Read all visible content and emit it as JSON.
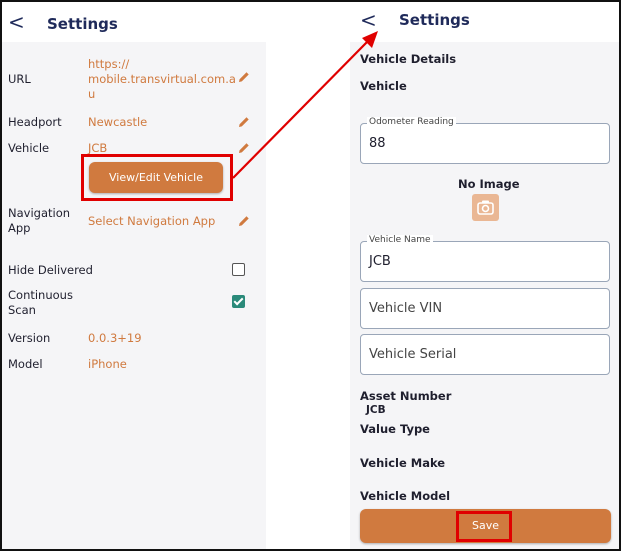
{
  "left": {
    "back_glyph": "<",
    "title": "Settings",
    "rows": [
      {
        "label": "URL",
        "value": "https://\nmobile.transvirtual.com.a\nu"
      },
      {
        "label": "Headport",
        "value": "Newcastle"
      },
      {
        "label": "Vehicle",
        "value": "JCB"
      },
      {
        "label": "Navigation\nApp",
        "value": "Select Navigation App"
      },
      {
        "label": "Hide Delivered",
        "checked": false
      },
      {
        "label": "Continuous\nScan",
        "checked": true
      },
      {
        "label": "Version",
        "value": "0.0.3+19"
      },
      {
        "label": "Model",
        "value": "iPhone"
      }
    ],
    "view_edit_button": "View/Edit Vehicle"
  },
  "right": {
    "back_glyph": "<",
    "title": "Settings",
    "section_title": "Vehicle Details",
    "vehicle_label": "Vehicle",
    "odometer": {
      "legend": "Odometer Reading",
      "value": "88"
    },
    "no_image": "No Image",
    "vehicle_name": {
      "legend": "Vehicle Name",
      "value": "JCB"
    },
    "vehicle_vin": {
      "placeholder": "Vehicle VIN"
    },
    "vehicle_serial": {
      "placeholder": "Vehicle Serial"
    },
    "asset_number_label": "Asset Number",
    "asset_number_value": "JCB",
    "value_type_label": "Value Type",
    "vehicle_make_label": "Vehicle Make",
    "vehicle_model_label": "Vehicle Model",
    "save_button": "Save"
  },
  "colors": {
    "accent": "#d07a3f",
    "header_text": "#1f2a5a",
    "highlight": "#e00000",
    "check": "#2a8a7a"
  },
  "icons": [
    "back-chevron-icon",
    "pencil-icon",
    "camera-icon",
    "checkbox-icon",
    "red-arrow-icon"
  ]
}
